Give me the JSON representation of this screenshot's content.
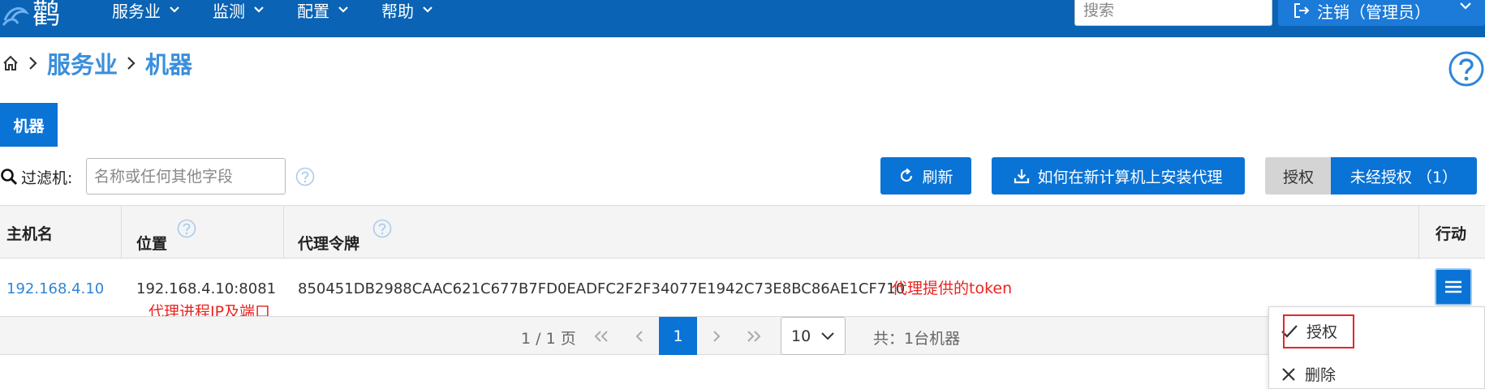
{
  "nav": {
    "logo_text": "鹳",
    "items": [
      {
        "label": "服务业"
      },
      {
        "label": "监测"
      },
      {
        "label": "配置"
      },
      {
        "label": "帮助"
      }
    ],
    "search_placeholder": "搜索",
    "logout_label": "注销（管理员）"
  },
  "breadcrumb": [
    "服务业",
    "机器"
  ],
  "tabs": [
    {
      "label": "机器",
      "active": true
    }
  ],
  "toolbar": {
    "filter_label": "过滤机:",
    "filter_placeholder": "名称或任何其他字段",
    "refresh_label": "刷新",
    "install_label": "如何在新计算机上安装代理",
    "authorized_label": "授权",
    "unauthorized_label": "未经授权 （1）"
  },
  "table": {
    "columns": [
      "主机名",
      "位置",
      "代理令牌",
      "行动"
    ],
    "rows": [
      {
        "hostname": "192.168.4.10",
        "location": "192.168.4.10:8081",
        "token": "850451DB2988CAAC621C677B7FD0EADFC2F2F34077E1942C73E8BC86AE1CF710"
      }
    ]
  },
  "annotations": {
    "location_note": "代理进程IP及端口",
    "token_note": "代理提供的token"
  },
  "pagination": {
    "page_info": "1 / 1 页",
    "current_page": "1",
    "page_size": "10",
    "total": "共：1台机器"
  },
  "action_menu": {
    "authorize_label": "授权",
    "delete_label": "删除"
  },
  "colors": {
    "nav_bg": "#0a63b4",
    "primary": "#0a73d6",
    "link": "#2f86d6",
    "annotation": "#e8251f"
  }
}
